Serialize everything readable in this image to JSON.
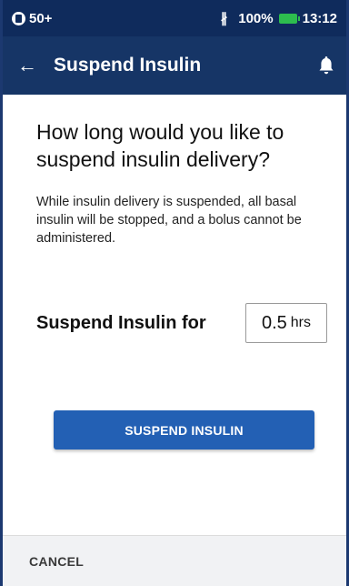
{
  "status_bar": {
    "signal_text": "50+",
    "battery_percent": "100%",
    "time": "13:12",
    "icons": [
      "sim-icon",
      "bluetooth-icon",
      "battery-icon"
    ]
  },
  "header": {
    "title": "Suspend Insulin",
    "back_icon": "arrow-left",
    "notification_icon": "bell"
  },
  "main": {
    "question": "How long would you like to suspend insulin delivery?",
    "description": "While insulin delivery is suspended, all basal insulin will be stopped, and a bolus cannot be administered.",
    "suspend_label": "Suspend Insulin for",
    "duration_value": "0.5",
    "duration_unit": "hrs",
    "suspend_button": "SUSPEND INSULIN"
  },
  "footer": {
    "cancel": "CANCEL"
  },
  "colors": {
    "header_bg": "#163566",
    "status_bg": "#0f2b5c",
    "button_bg": "#2360b4",
    "battery": "#2dbd4e"
  }
}
